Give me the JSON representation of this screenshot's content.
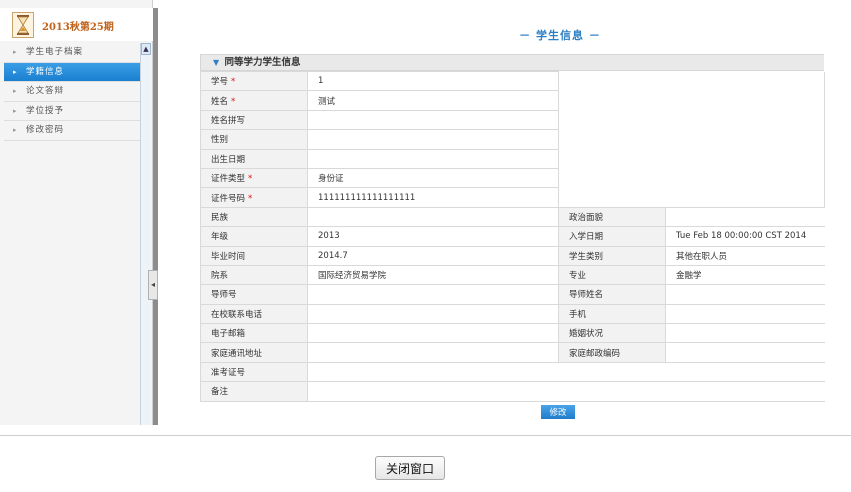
{
  "sidebar": {
    "term_title": "2013秋第25期",
    "menu": [
      {
        "label": "学生电子档案",
        "active": false
      },
      {
        "label": "学籍信息",
        "active": true
      },
      {
        "label": "论文答辩",
        "active": false
      },
      {
        "label": "学位授予",
        "active": false
      },
      {
        "label": "修改密码",
        "active": false
      }
    ]
  },
  "main": {
    "title": "－ 学生信息 －",
    "panel_title": "同等学力学生信息",
    "fields": {
      "student_no": {
        "label": "学号",
        "value": "1"
      },
      "name": {
        "label": "姓名",
        "value": "测试"
      },
      "name_pinyin": {
        "label": "姓名拼写",
        "value": ""
      },
      "gender": {
        "label": "性别",
        "value": ""
      },
      "birth_date": {
        "label": "出生日期",
        "value": ""
      },
      "id_type": {
        "label": "证件类型",
        "value": "身份证"
      },
      "id_no": {
        "label": "证件号码",
        "value": "111111111111111111"
      },
      "ethnicity": {
        "label": "民族",
        "value": ""
      },
      "political": {
        "label": "政治面貌",
        "value": ""
      },
      "grade": {
        "label": "年级",
        "value": "2013"
      },
      "enroll_date": {
        "label": "入学日期",
        "value": "Tue Feb 18 00:00:00 CST 2014"
      },
      "grad_time": {
        "label": "毕业时间",
        "value": "2014.7"
      },
      "student_type": {
        "label": "学生类别",
        "value": "其他在职人员"
      },
      "department": {
        "label": "院系",
        "value": "国际经济贸易学院"
      },
      "major": {
        "label": "专业",
        "value": "金融学"
      },
      "advisor_no": {
        "label": "导师号",
        "value": ""
      },
      "advisor_name": {
        "label": "导师姓名",
        "value": ""
      },
      "school_phone": {
        "label": "在校联系电话",
        "value": ""
      },
      "mobile": {
        "label": "手机",
        "value": ""
      },
      "email": {
        "label": "电子邮箱",
        "value": ""
      },
      "marital": {
        "label": "婚姻状况",
        "value": ""
      },
      "home_address": {
        "label": "家庭通讯地址",
        "value": ""
      },
      "home_zip": {
        "label": "家庭邮政编码",
        "value": ""
      },
      "exam_no": {
        "label": "准考证号",
        "value": ""
      },
      "remarks": {
        "label": "备注",
        "value": ""
      }
    },
    "required_mark": "*",
    "edit_label": "修改"
  },
  "footer": {
    "close_label": "关闭窗口"
  }
}
